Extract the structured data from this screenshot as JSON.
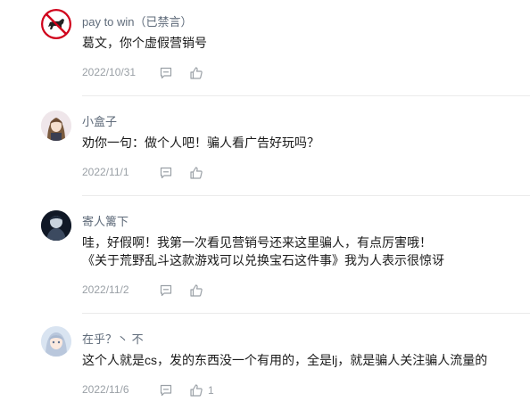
{
  "comments": [
    {
      "author": "pay to win",
      "status": "（已禁言）",
      "lines": [
        "葛文，你个虚假营销号"
      ],
      "date": "2022/10/31",
      "likes": ""
    },
    {
      "author": "小盒子",
      "status": "",
      "lines": [
        "劝你一句：做个人吧！骗人看广告好玩吗？"
      ],
      "date": "2022/11/1",
      "likes": ""
    },
    {
      "author": "寄人篱下",
      "status": "",
      "lines": [
        "哇，好假啊！我第一次看见营销号还来这里骗人，有点厉害哦！",
        "《关于荒野乱斗这款游戏可以兑换宝石这件事》我为人表示很惊讶"
      ],
      "date": "2022/11/2",
      "likes": ""
    },
    {
      "author": "在乎？丶 不",
      "status": "",
      "lines": [
        "这个人就是cs，发的东西没一个有用的，全是lj，就是骗人关注骗人流量的"
      ],
      "date": "2022/11/6",
      "likes": "1"
    }
  ],
  "icons": {
    "reply": "comment-icon",
    "like": "thumbs-up-icon"
  },
  "colors": {
    "name": "#5f6b7a",
    "meta": "#9aa0a6",
    "ban_sign": "#d0021b"
  }
}
